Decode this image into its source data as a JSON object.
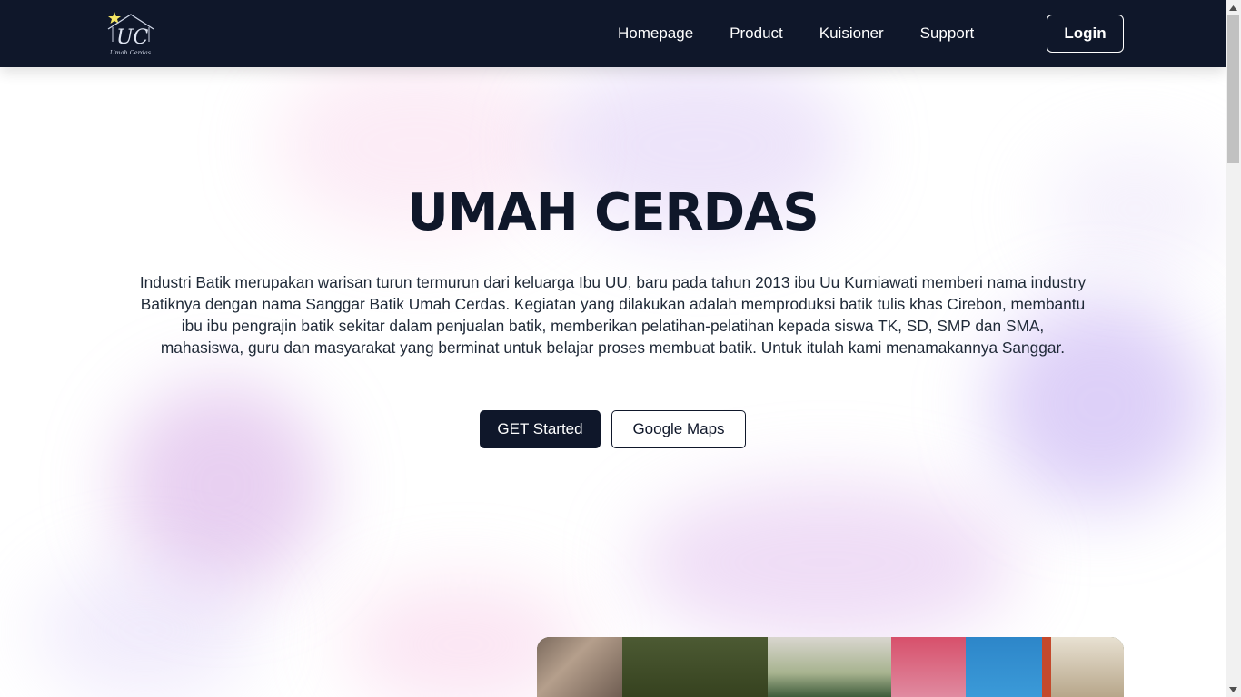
{
  "nav": {
    "logo_alt": "Umah Cerdas",
    "links": [
      {
        "label": "Homepage"
      },
      {
        "label": "Product"
      },
      {
        "label": "Kuisioner"
      },
      {
        "label": "Support"
      }
    ],
    "login_label": "Login"
  },
  "hero": {
    "title": "UMAH CERDAS",
    "description": "Industri Batik merupakan warisan turun termurun dari keluarga Ibu UU, baru pada tahun 2013 ibu Uu Kurniawati memberi nama industry Batiknya dengan nama Sanggar Batik Umah Cerdas. Kegiatan yang dilakukan adalah memproduksi batik tulis khas Cirebon, membantu ibu ibu pengrajin batik sekitar dalam penjualan batik, memberikan pelatihan-pelatihan kepada siswa TK, SD, SMP dan SMA, mahasiswa, guru dan masyarakat yang berminat untuk belajar proses membuat batik. Untuk itulah kami menamakannya Sanggar.",
    "primary_button": "GET Started",
    "secondary_button": "Google Maps"
  },
  "colors": {
    "navbar_bg": "#0f172a",
    "primary": "#0f172a",
    "logo_star": "#f5e663"
  }
}
